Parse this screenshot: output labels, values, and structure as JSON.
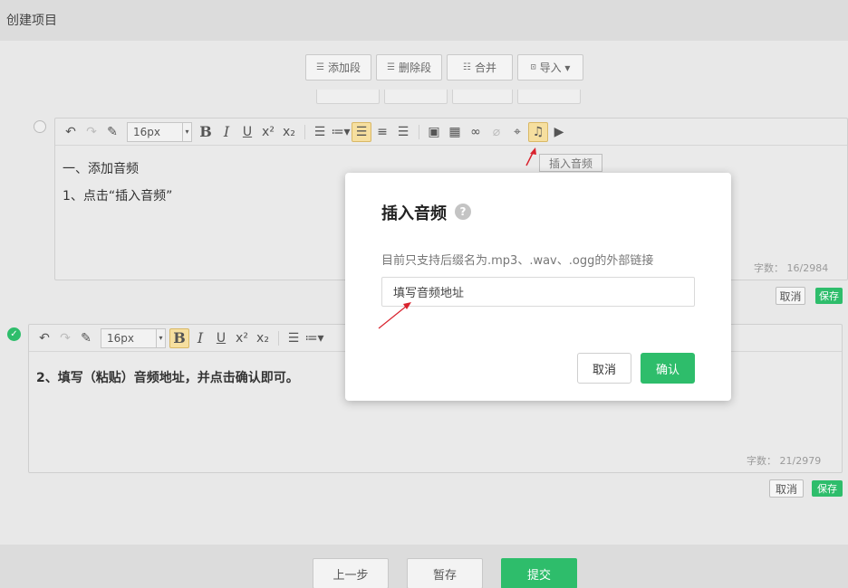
{
  "header": {
    "title": "创建项目"
  },
  "segment_toolbar": {
    "add": "添加段",
    "delete": "删除段",
    "merge": "合并",
    "import": "导入 ▾"
  },
  "editor1": {
    "font_size": "16px",
    "line1": "一、添加音频",
    "line2": "1、点击“插入音频”",
    "counter": "字数： 16/2984",
    "tooltip": "插入音频",
    "cancel": "取消",
    "save": "保存"
  },
  "editor2": {
    "font_size": "16px",
    "line1": "2、填写（粘贴）音频地址，并点击确认即可。",
    "counter": "字数： 21/2979",
    "cancel": "取消",
    "save": "保存"
  },
  "modal": {
    "title": "插入音频",
    "help": "?",
    "hint": "目前只支持后缀名为.mp3、.wav、.ogg的外部链接",
    "input_value": "填写音频地址",
    "cancel": "取消",
    "confirm": "确认"
  },
  "footer": {
    "prev": "上一步",
    "draft": "暂存",
    "submit": "提交"
  },
  "colors": {
    "accent": "#2ebd6b",
    "arrow": "#d9232e",
    "highlight": "#f6df9f"
  }
}
